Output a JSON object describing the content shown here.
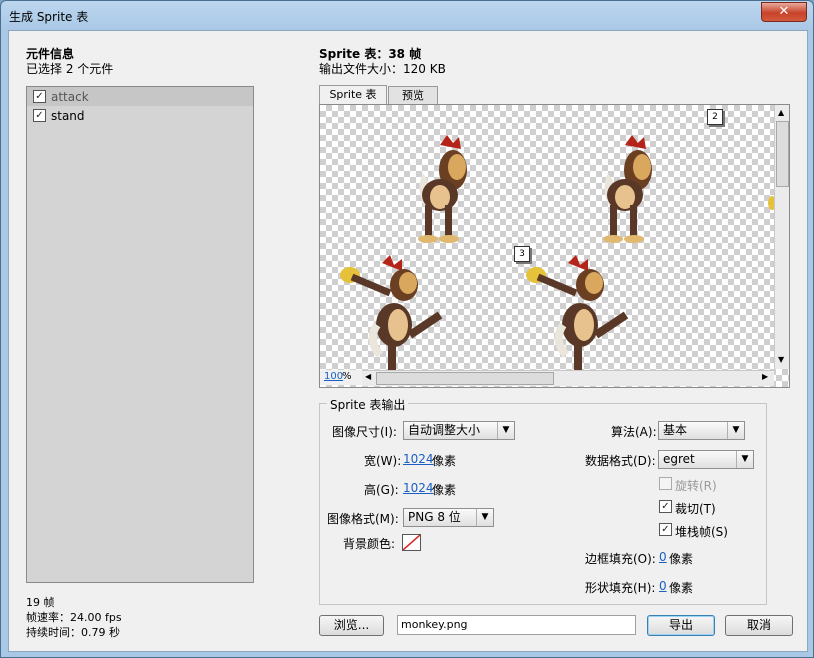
{
  "window": {
    "title": "生成 Sprite 表",
    "close_symbol": "✕"
  },
  "left": {
    "heading": "元件信息",
    "selected_info": "已选择 2 个元件",
    "items": [
      {
        "label": "attack",
        "checked": true
      },
      {
        "label": "stand",
        "checked": true
      }
    ],
    "frames": "19 帧",
    "fps": "帧速率：24.00 fps",
    "duration": "持续时间：0.79 秒"
  },
  "right": {
    "sprite_title": "Sprite 表：38 帧",
    "file_size": "输出文件大小：120 KB",
    "tabs": [
      "Sprite 表",
      "预览"
    ],
    "zoom_value": "100",
    "zoom_unit": "%",
    "frame_badges": [
      "2",
      "3"
    ]
  },
  "output": {
    "legend": "Sprite 表输出",
    "image_size_label": "图像尺寸(I):",
    "image_size_value": "自动调整大小",
    "width_label": "宽(W):",
    "width_value": "1024",
    "height_label": "高(G):",
    "height_value": "1024",
    "pixel_unit": "像素",
    "image_format_label": "图像格式(M):",
    "image_format_value": "PNG 8 位",
    "bg_color_label": "背景颜色:",
    "algorithm_label": "算法(A):",
    "algorithm_value": "基本",
    "data_format_label": "数据格式(D):",
    "data_format_value": "egret",
    "rotate_label": "旋转(R)",
    "trim_label": "裁切(T)",
    "stack_label": "堆栈帧(S)",
    "border_padding_label": "边框填充(O):",
    "border_padding_value": "0",
    "shape_padding_label": "形状填充(H):",
    "shape_padding_value": "0",
    "padding_unit": "像素"
  },
  "footer": {
    "browse_label": "浏览...",
    "filename": "monkey.png",
    "export_label": "导出",
    "cancel_label": "取消"
  },
  "colors": {
    "title_bar": "#a9c8e6",
    "close_button": "#c7432a",
    "link_blue": "#1a5fc2"
  }
}
